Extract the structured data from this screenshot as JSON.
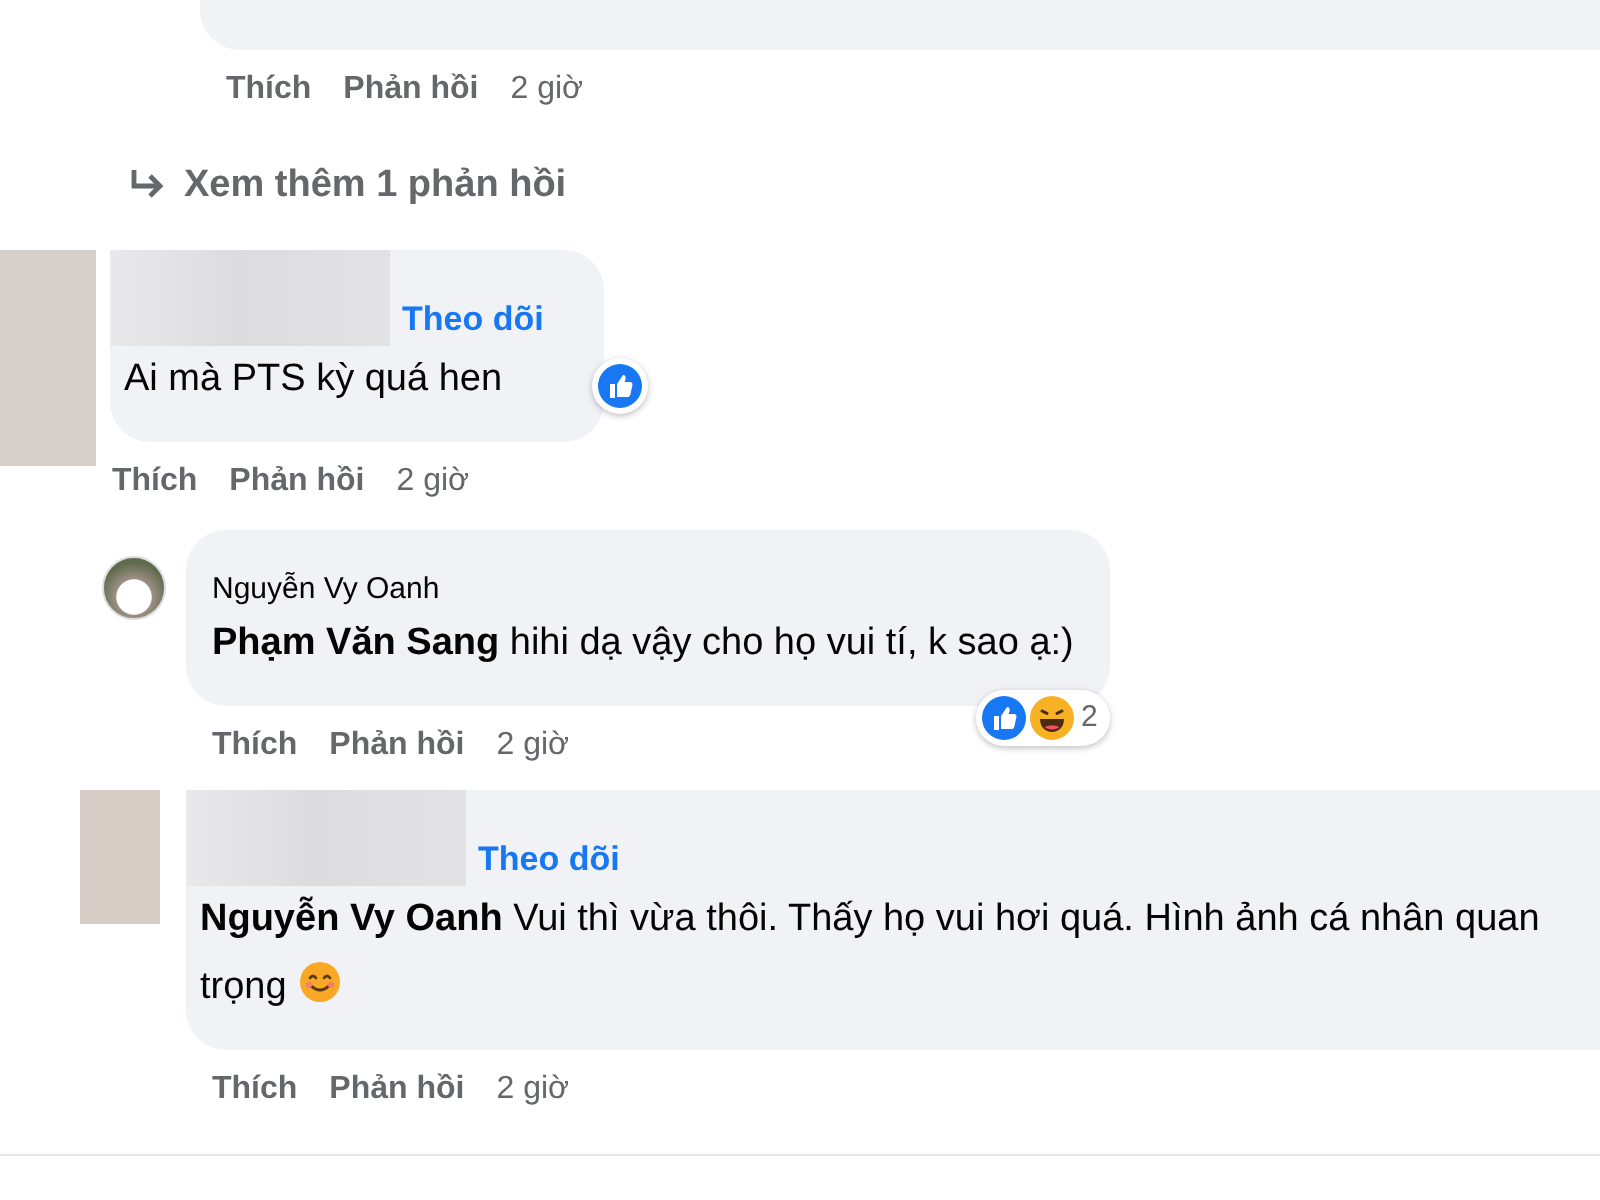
{
  "top_reply": {
    "actions": {
      "like": "Thích",
      "reply": "Phản hồi",
      "time": "2 giờ"
    }
  },
  "view_more": {
    "label": "Xem thêm 1 phản hồi"
  },
  "comments": [
    {
      "kind": "masked",
      "follow": "Theo dõi",
      "text": "Ai mà PTS kỳ quá hen",
      "emoji": false,
      "reactions": {
        "icons": [
          {
            "kind": "like"
          }
        ]
      },
      "actions": {
        "like": "Thích",
        "reply": "Phản hồi",
        "time": "2 giờ"
      },
      "children": [
        {
          "kind": "named",
          "name": "Nguyễn Vy Oanh",
          "text": "**Phạm Văn Sang** hihi dạ vậy cho họ vui tí, k sao ạ:)",
          "emoji": false,
          "reactions": {
            "icons": [
              {
                "kind": "like"
              },
              {
                "kind": "haha"
              }
            ],
            "count": "2"
          },
          "actions": {
            "like": "Thích",
            "reply": "Phản hồi",
            "time": "2 giờ"
          }
        },
        {
          "kind": "masked",
          "follow": "Theo dõi",
          "text": "**Nguyễn Vy Oanh** Vui thì vừa thôi. Thấy họ vui hơi quá. Hình ảnh cá nhân quan trọng",
          "emoji": true,
          "actions": {
            "like": "Thích",
            "reply": "Phản hồi",
            "time": "2 giờ"
          }
        }
      ]
    }
  ]
}
